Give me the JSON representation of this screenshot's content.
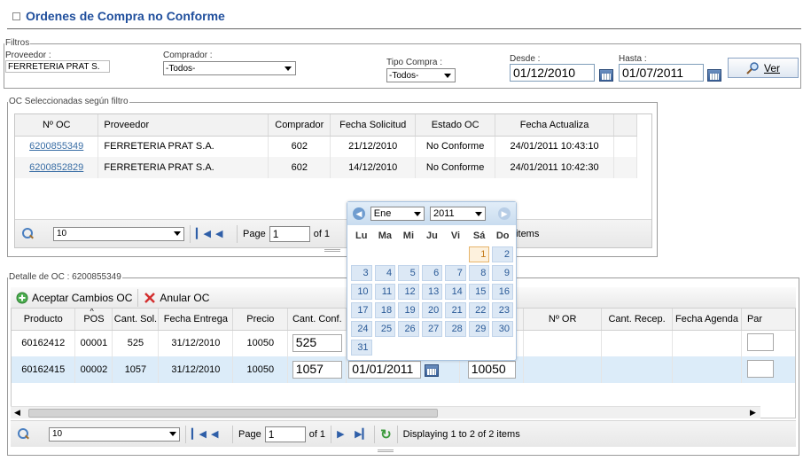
{
  "page": {
    "title": "Ordenes de Compra no Conforme"
  },
  "filtros": {
    "legend": "Filtros",
    "proveedor_label": "Proveedor :",
    "proveedor_value": "FERRETERIA PRAT S.",
    "comprador_label": "Comprador :",
    "comprador_value": "-Todos-",
    "tipo_label": "Tipo Compra :",
    "tipo_value": "-Todos-",
    "desde_label": "Desde :",
    "desde_value": "01/12/2010",
    "hasta_label": "Hasta :",
    "hasta_value": "01/07/2011",
    "ver_label": "Ver"
  },
  "oc_grid": {
    "legend": "OC Seleccionadas según filtro",
    "columns": [
      "Nº OC",
      "Proveedor",
      "Comprador",
      "Fecha Solicitud",
      "Estado OC",
      "Fecha Actualiza"
    ],
    "rows": [
      [
        "6200855349",
        "FERRETERIA PRAT S.A.",
        "602",
        "21/12/2010",
        "No Conforme",
        "24/01/2011 10:43:10"
      ],
      [
        "6200852829",
        "FERRETERIA PRAT S.A.",
        "602",
        "14/12/2010",
        "No Conforme",
        "24/01/2011 10:42:30"
      ]
    ],
    "pager": {
      "page_size": "10",
      "page_label": "Page",
      "page": "1",
      "of_label": "of 1",
      "display": "items"
    }
  },
  "detalle": {
    "legend": "Detalle de OC : 6200855349",
    "aceptar_label": "Aceptar Cambios OC",
    "anular_label": "Anular OC",
    "columns": [
      "Producto",
      "POS",
      "Cant. Sol.",
      "Fecha Entrega",
      "Precio",
      "Cant. Conf.",
      "Nº OR",
      "Cant. Recep.",
      "Fecha Agenda",
      "Par"
    ],
    "rows": [
      {
        "producto": "60162412",
        "pos": "00001",
        "cant_sol": "525",
        "fecha": "31/12/2010",
        "precio": "10050",
        "cant_conf": "525"
      },
      {
        "producto": "60162415",
        "pos": "00002",
        "cant_sol": "1057",
        "fecha": "31/12/2010",
        "precio": "10050",
        "cant_conf": "1057",
        "edit_fecha": "01/01/2011",
        "edit_precio": "10050"
      }
    ],
    "pager": {
      "page_size": "10",
      "page_label": "Page",
      "page": "1",
      "of_label": "of 1",
      "display": "Displaying 1 to 2 of 2 items"
    }
  },
  "calendar": {
    "month": "Ene",
    "year": "2011",
    "weekdays": [
      "Lu",
      "Ma",
      "Mi",
      "Ju",
      "Vi",
      "Sá",
      "Do"
    ],
    "weeks": [
      [
        "",
        "",
        "",
        "",
        "",
        "1",
        "2"
      ],
      [
        "3",
        "4",
        "5",
        "6",
        "7",
        "8",
        "9"
      ],
      [
        "10",
        "11",
        "12",
        "13",
        "14",
        "15",
        "16"
      ],
      [
        "17",
        "18",
        "19",
        "20",
        "21",
        "22",
        "23"
      ],
      [
        "24",
        "25",
        "26",
        "27",
        "28",
        "29",
        "30"
      ],
      [
        "31",
        "",
        "",
        "",
        "",
        "",
        ""
      ]
    ],
    "today": "1"
  }
}
